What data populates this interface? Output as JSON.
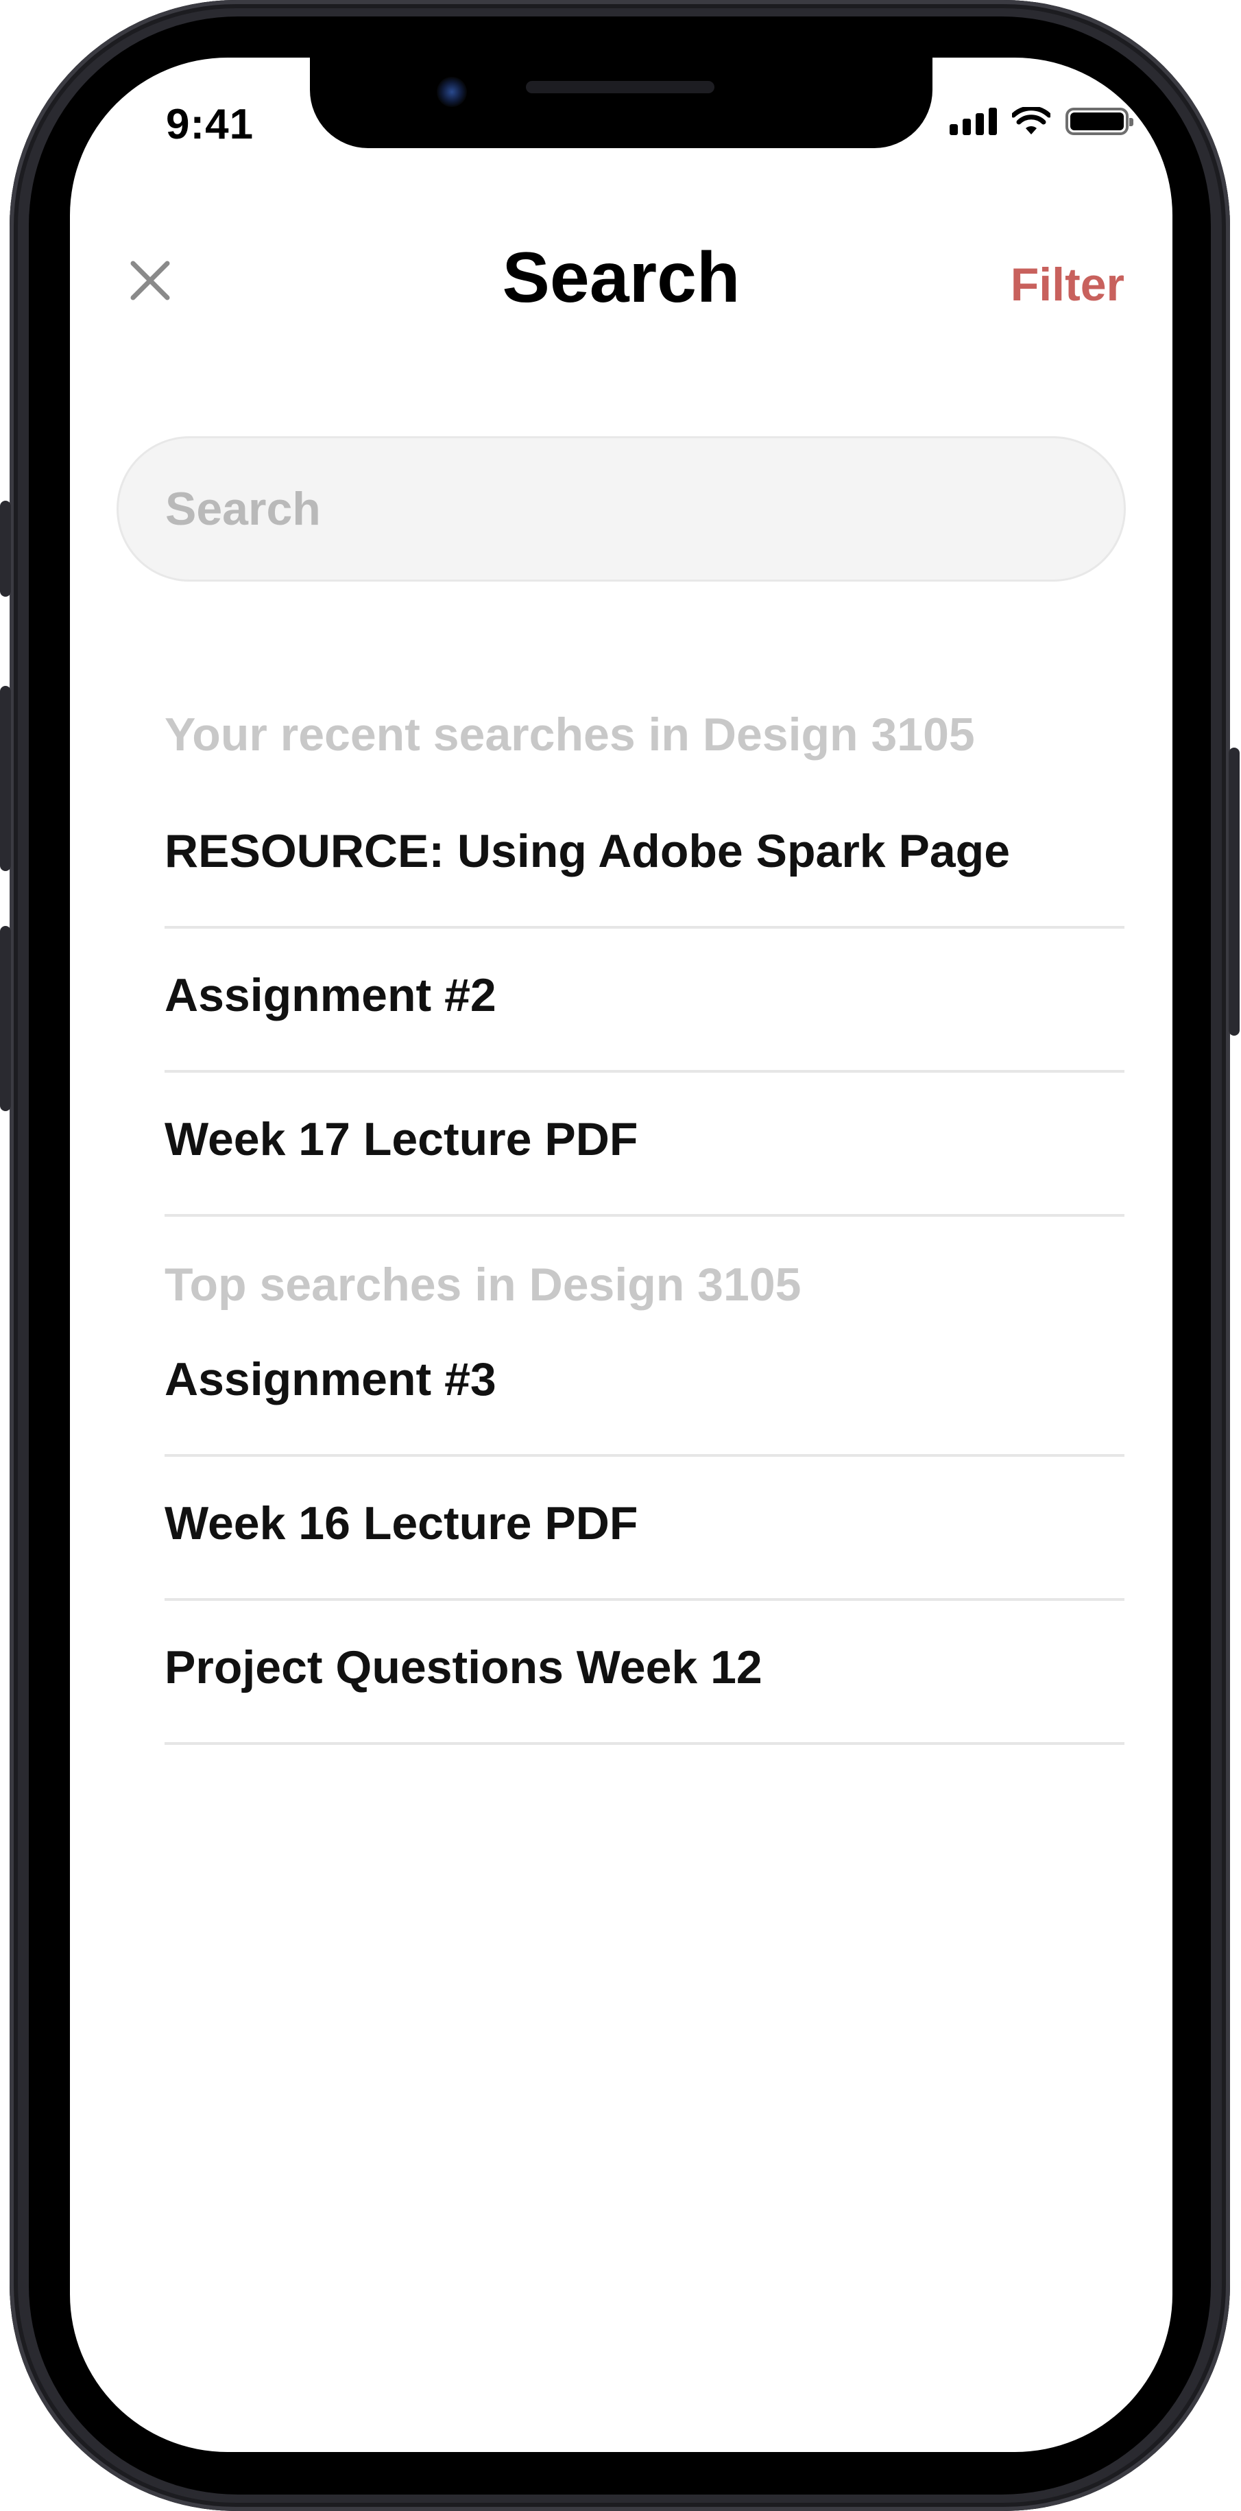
{
  "status_bar": {
    "time": "9:41",
    "icons": [
      "cellular-signal-icon",
      "wifi-icon",
      "battery-icon"
    ]
  },
  "nav": {
    "close_icon": "close-icon",
    "title": "Search",
    "filter_label": "Filter"
  },
  "search": {
    "placeholder": "Search",
    "value": ""
  },
  "recent": {
    "heading": "Your recent searches in Design 3105",
    "items": [
      "RESOURCE: Using Adobe Spark Page",
      "Assignment #2",
      "Week 17 Lecture PDF"
    ]
  },
  "top": {
    "heading": "Top searches in Design 3105",
    "items": [
      "Assignment #3",
      "Week 16 Lecture PDF",
      "Project Questions Week 12"
    ]
  },
  "colors": {
    "accent": "#c8615d",
    "secondary_text": "#c8c8c8",
    "search_field_bg": "#f4f4f4"
  }
}
